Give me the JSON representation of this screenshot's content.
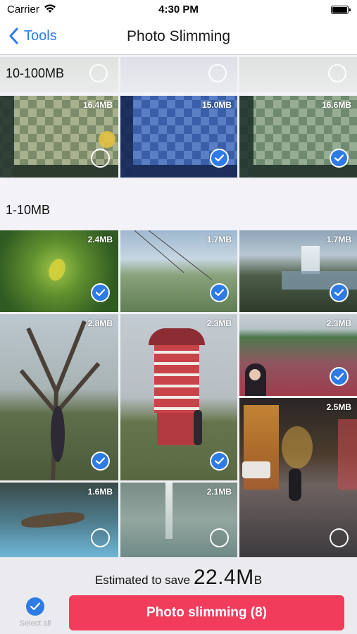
{
  "status": {
    "carrier": "Carrier",
    "time": "4:30 PM"
  },
  "nav": {
    "back_label": "Tools",
    "title": "Photo Slimming"
  },
  "sections": [
    {
      "label": "10-100MB"
    },
    {
      "label": "1-10MB"
    }
  ],
  "photos": [
    {
      "size": "16.4MB",
      "selected": false,
      "scene": "game-board"
    },
    {
      "size": "15.0MB",
      "selected": true,
      "scene": "game-board-blue"
    },
    {
      "size": "16.6MB",
      "selected": true,
      "scene": "game-board"
    },
    {
      "size": "2.4MB",
      "selected": true,
      "scene": "leaves"
    },
    {
      "size": "1.7MB",
      "selected": true,
      "scene": "hillside-wires"
    },
    {
      "size": "1.7MB",
      "selected": true,
      "scene": "waterfall"
    },
    {
      "size": "2.8MB",
      "selected": true,
      "scene": "tree-person"
    },
    {
      "size": "2.3MB",
      "selected": true,
      "scene": "windmill"
    },
    {
      "size": "2.3MB",
      "selected": true,
      "scene": "tulip-field"
    },
    {
      "size": "2.5MB",
      "selected": false,
      "scene": "night-street"
    },
    {
      "size": "1.6MB",
      "selected": false,
      "scene": "aquarium"
    },
    {
      "size": "2.1MB",
      "selected": false,
      "scene": "cave-waterfall"
    }
  ],
  "bottom": {
    "estimate_prefix": "Estimated to save",
    "estimate_value": "22.4M",
    "estimate_unit": "B",
    "select_all_label": "Select all",
    "slim_button_label": "Photo slimming (8)"
  },
  "colors": {
    "accent": "#2f7be5",
    "action": "#f23c5c"
  }
}
